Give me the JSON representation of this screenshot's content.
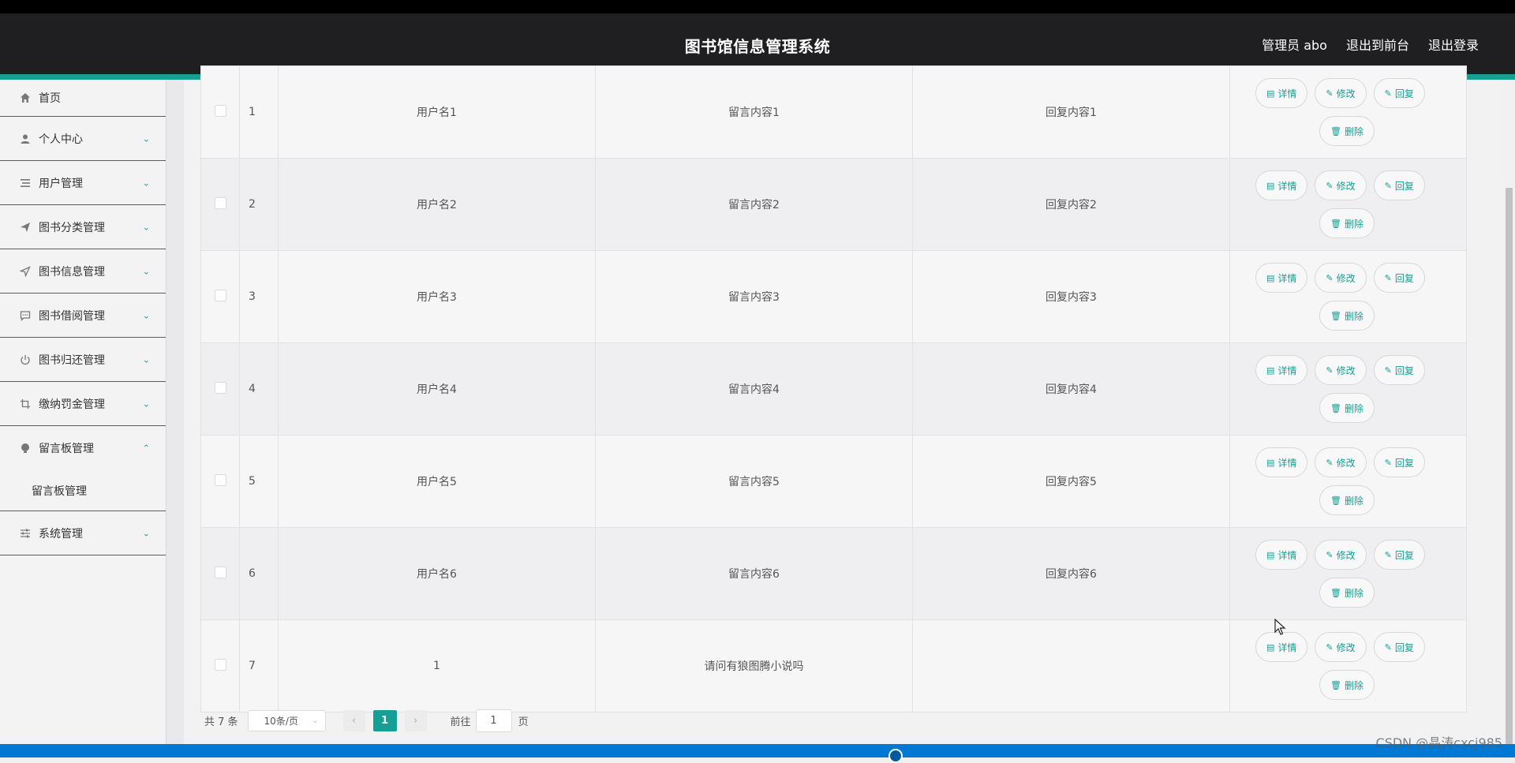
{
  "header": {
    "title": "图书馆信息管理系统",
    "user_label": "管理员 abo",
    "front_label": "退出到前台",
    "logout_label": "退出登录"
  },
  "sidebar": {
    "items": [
      {
        "label": "首页",
        "icon": "home-icon"
      },
      {
        "label": "个人中心",
        "icon": "user-icon"
      },
      {
        "label": "用户管理",
        "icon": "list-icon"
      },
      {
        "label": "图书分类管理",
        "icon": "send-icon"
      },
      {
        "label": "图书信息管理",
        "icon": "navigation-icon"
      },
      {
        "label": "图书借阅管理",
        "icon": "chat-icon"
      },
      {
        "label": "图书归还管理",
        "icon": "power-icon"
      },
      {
        "label": "缴纳罚金管理",
        "icon": "crop-icon"
      },
      {
        "label": "留言板管理",
        "icon": "bulb-icon"
      },
      {
        "label": "系统管理",
        "icon": "sliders-icon"
      }
    ],
    "submenu_label": "留言板管理"
  },
  "table": {
    "rows": [
      {
        "index": "1",
        "username": "用户名1",
        "message": "留言内容1",
        "reply": "回复内容1"
      },
      {
        "index": "2",
        "username": "用户名2",
        "message": "留言内容2",
        "reply": "回复内容2"
      },
      {
        "index": "3",
        "username": "用户名3",
        "message": "留言内容3",
        "reply": "回复内容3"
      },
      {
        "index": "4",
        "username": "用户名4",
        "message": "留言内容4",
        "reply": "回复内容4"
      },
      {
        "index": "5",
        "username": "用户名5",
        "message": "留言内容5",
        "reply": "回复内容5"
      },
      {
        "index": "6",
        "username": "用户名6",
        "message": "留言内容6",
        "reply": "回复内容6"
      },
      {
        "index": "7",
        "username": "1",
        "message": "请问有狼图腾小说吗",
        "reply": ""
      }
    ],
    "actions": {
      "detail": "详情",
      "edit": "修改",
      "reply": "回复",
      "delete": "删除"
    }
  },
  "pagination": {
    "total": "共 7 条",
    "page_size": "10条/页",
    "current_page": "1",
    "goto_label": "前往",
    "goto_value": "1",
    "page_suffix": "页"
  },
  "watermark": "CSDN @晶涛cxcj985",
  "colors": {
    "accent": "#14a095",
    "header_bg": "#1f1f21"
  }
}
